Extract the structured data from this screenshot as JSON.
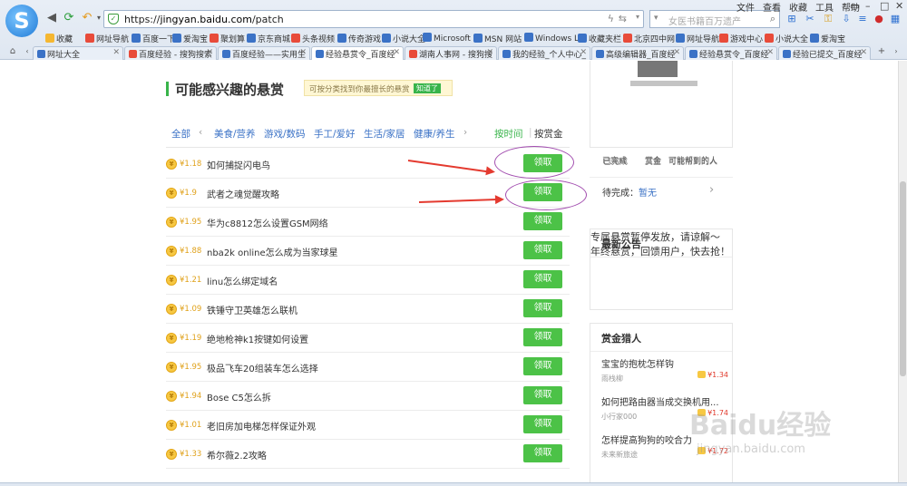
{
  "browser": {
    "logo_letter": "S",
    "url_prefix": "https://",
    "url_host": "jingyan.baidu.com",
    "url_path": "/patch",
    "search_placeholder": "女医书籍百万遗产",
    "menus": [
      "文件",
      "查看",
      "收藏",
      "工具",
      "帮助"
    ],
    "favorites": [
      "收藏",
      "网址导航",
      "百度一下",
      "爱淘宝",
      "聚划算",
      "京东商城",
      "头条视频",
      "传奇游戏",
      "小说大全",
      "Microsoft",
      "MSN 网站",
      "Windows Li",
      "收藏夹栏",
      "北京四中网",
      "网址导航",
      "游戏中心",
      "小说大全",
      "爱淘宝"
    ],
    "tabs": [
      "网址大全",
      "百度经验 - 搜狗搜索",
      "百度经验——实用生",
      "经验悬赏令_百度经",
      "湖南人事网 - 搜狗搜",
      "我的经验_个人中心_",
      "高级编辑器_百度经",
      "经验悬赏令_百度经",
      "经验已提交_百度经"
    ],
    "active_tab": 3
  },
  "section": {
    "title": "可能感兴趣的悬赏",
    "tip": "可按分类找到你最擅长的悬赏",
    "tip_button": "知道了"
  },
  "categories": [
    "全部",
    "美食/营养",
    "游戏/数码",
    "手工/爱好",
    "生活/家居",
    "健康/养生"
  ],
  "sort": {
    "by_time": "按时间",
    "by_reward": "按赏金"
  },
  "bounties": [
    {
      "amount": "¥1.18",
      "question": "如何捕捉闪电鸟",
      "action": "领取"
    },
    {
      "amount": "¥1.9",
      "question": "武者之魂觉醒攻略",
      "action": "领取"
    },
    {
      "amount": "¥1.95",
      "question": "华为c8812怎么设置GSM网络",
      "action": "领取"
    },
    {
      "amount": "¥1.88",
      "question": "nba2k online怎么成为当家球星",
      "action": "领取"
    },
    {
      "amount": "¥1.21",
      "question": "linu怎么绑定域名",
      "action": "领取"
    },
    {
      "amount": "¥1.09",
      "question": "铁锤守卫英雄怎么联机",
      "action": "领取"
    },
    {
      "amount": "¥1.19",
      "question": "绝地枪神k1按键如何设置",
      "action": "领取"
    },
    {
      "amount": "¥1.95",
      "question": "极品飞车20组装车怎么选择",
      "action": "领取"
    },
    {
      "amount": "¥1.94",
      "question": "Bose C5怎么拆",
      "action": "领取"
    },
    {
      "amount": "¥1.01",
      "question": "老旧房加电梯怎样保证外观",
      "action": "领取"
    },
    {
      "amount": "¥1.33",
      "question": "希尔薇2.2攻略",
      "action": "领取"
    }
  ],
  "profile": {
    "stats": [
      "已完成",
      "赏金",
      "可能帮到的人"
    ],
    "pending_label": "待完成：",
    "pending_value": "暂无"
  },
  "announcements": {
    "title": "最新公告",
    "items": [
      "专属悬赏暂停发放，请谅解～",
      "年终悬赏，回馈用户，快去抢！"
    ]
  },
  "hunters": {
    "title": "赏金猎人",
    "items": [
      {
        "title": "宝宝的抱枕怎样钩",
        "user": "雨栈柳",
        "reward": "¥1.34"
      },
      {
        "title": "如何把路由器当成交换机用...",
        "user": "小行家000",
        "reward": "¥1.74"
      },
      {
        "title": "怎样提高狗狗的咬合力",
        "user": "未来新旅途",
        "reward": "¥1.72"
      }
    ]
  },
  "watermark": {
    "brand": "Baidu经验",
    "site": "jingyan.baidu.com"
  },
  "colors": {
    "accent": "#38b44a",
    "button": "#4cc247",
    "link": "#3b72c6",
    "annotation_arrow": "#e43a2f",
    "annotation_circle": "#a34fb0"
  }
}
